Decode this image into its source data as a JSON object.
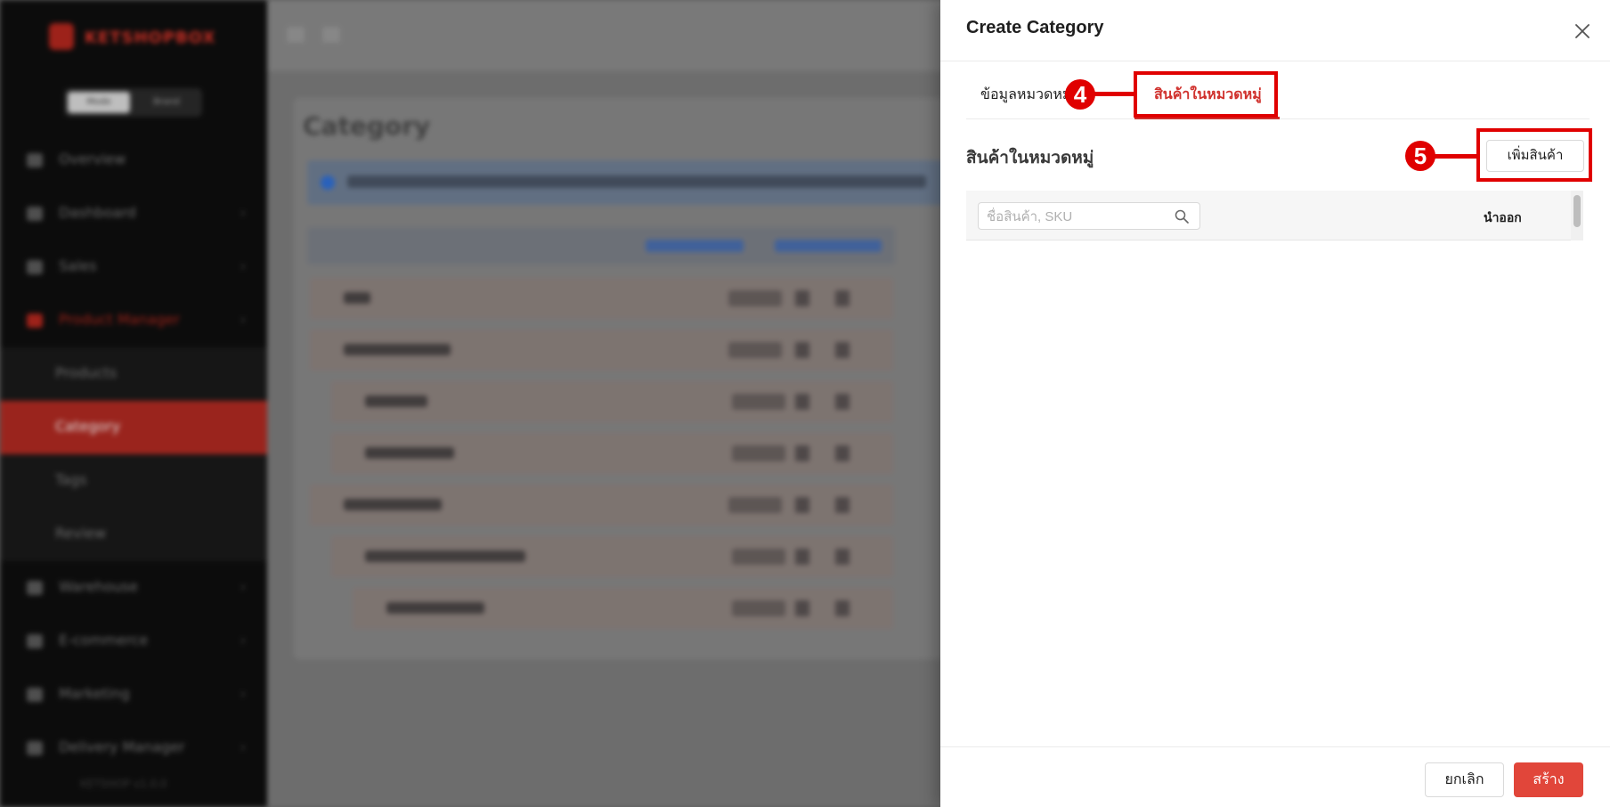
{
  "background": {
    "logo_text": "KETSHOP",
    "logo_accent": "BOX",
    "switch": [
      "Mode",
      "Brand"
    ],
    "nav_items": [
      {
        "label": "Overview",
        "icon": "grid-icon"
      },
      {
        "label": "Dashboard",
        "icon": "chart-icon"
      },
      {
        "label": "Sales",
        "icon": "cart-icon"
      },
      {
        "label": "Product Manager",
        "icon": "tag-icon"
      },
      {
        "label": "Warehouse",
        "icon": "warehouse-icon"
      },
      {
        "label": "E-commerce",
        "icon": "store-icon"
      },
      {
        "label": "Marketing",
        "icon": "megaphone-icon"
      },
      {
        "label": "Delivery Manager",
        "icon": "truck-icon"
      }
    ],
    "sub_items": [
      "Products",
      "Category",
      "Tags",
      "Review"
    ],
    "footer": "KETSHOP v1.0.0",
    "page_title": "Category"
  },
  "drawer": {
    "title": "Create Category",
    "tabs": [
      {
        "label": "ข้อมูลหมวดหมู่",
        "active": false
      },
      {
        "label": "สินค้าในหมวดหมู่",
        "active": true
      }
    ],
    "section_title": "สินค้าในหมวดหมู่",
    "add_button": "เพิ่มสินค้า",
    "search_placeholder": "ชื่อสินค้า, SKU",
    "search_value": "",
    "column_remove": "นำออก",
    "cancel_button": "ยกเลิก",
    "create_button": "สร้าง"
  },
  "callouts": [
    {
      "number": "4",
      "target": "tab-products"
    },
    {
      "number": "5",
      "target": "add-product-button"
    }
  ],
  "colors": {
    "accent": "#d0312d",
    "primary_button": "#e1463a",
    "callout": "#e00000",
    "sidebar_active": "#b02a22"
  }
}
